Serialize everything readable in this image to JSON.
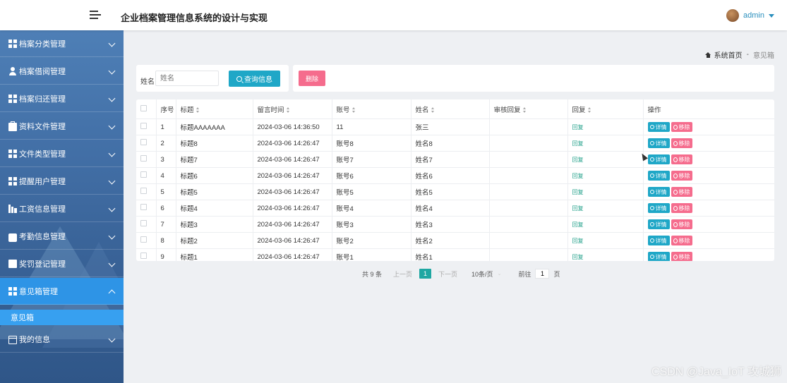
{
  "header": {
    "title": "企业档案管理信息系统的设计与实现",
    "username": "admin"
  },
  "sidebar": {
    "items": [
      {
        "label": "档案分类管理",
        "icon": "grid-icon"
      },
      {
        "label": "档案借阅管理",
        "icon": "user-icon"
      },
      {
        "label": "档案归还管理",
        "icon": "grid-icon"
      },
      {
        "label": "资料文件管理",
        "icon": "briefcase-icon"
      },
      {
        "label": "文件类型管理",
        "icon": "grid-icon"
      },
      {
        "label": "提醒用户管理",
        "icon": "grid-icon"
      },
      {
        "label": "工资信息管理",
        "icon": "bar-chart-icon"
      },
      {
        "label": "考勤信息管理",
        "icon": "drive-icon"
      },
      {
        "label": "奖罚登记管理",
        "icon": "checkbox-icon"
      },
      {
        "label": "意见箱管理",
        "icon": "grid-icon"
      },
      {
        "label": "我的信息",
        "icon": "card-icon"
      }
    ],
    "active_sub_item": "意见箱"
  },
  "breadcrumb": {
    "home": "系统首页",
    "separator": "-",
    "current": "意见箱"
  },
  "search": {
    "label": "姓名",
    "placeholder": "姓名",
    "button": "查询信息"
  },
  "actions": {
    "delete": "删除"
  },
  "table": {
    "headers": [
      "序号",
      "标题",
      "留言时间",
      "账号",
      "姓名",
      "审核回复",
      "回复",
      "操作"
    ],
    "rows": [
      {
        "no": "1",
        "title": "标题AAAAAAA",
        "time": "2024-03-06 14:36:50",
        "account": "11",
        "name": "张三",
        "review": "",
        "reply": "回复"
      },
      {
        "no": "2",
        "title": "标题8",
        "time": "2024-03-06 14:26:47",
        "account": "账号8",
        "name": "姓名8",
        "review": "",
        "reply": "回复"
      },
      {
        "no": "3",
        "title": "标题7",
        "time": "2024-03-06 14:26:47",
        "account": "账号7",
        "name": "姓名7",
        "review": "",
        "reply": "回复"
      },
      {
        "no": "4",
        "title": "标题6",
        "time": "2024-03-06 14:26:47",
        "account": "账号6",
        "name": "姓名6",
        "review": "",
        "reply": "回复"
      },
      {
        "no": "5",
        "title": "标题5",
        "time": "2024-03-06 14:26:47",
        "account": "账号5",
        "name": "姓名5",
        "review": "",
        "reply": "回复"
      },
      {
        "no": "6",
        "title": "标题4",
        "time": "2024-03-06 14:26:47",
        "account": "账号4",
        "name": "姓名4",
        "review": "",
        "reply": "回复"
      },
      {
        "no": "7",
        "title": "标题3",
        "time": "2024-03-06 14:26:47",
        "account": "账号3",
        "name": "姓名3",
        "review": "",
        "reply": "回复"
      },
      {
        "no": "8",
        "title": "标题2",
        "time": "2024-03-06 14:26:47",
        "account": "账号2",
        "name": "姓名2",
        "review": "",
        "reply": "回复"
      },
      {
        "no": "9",
        "title": "标题1",
        "time": "2024-03-06 14:26:47",
        "account": "账号1",
        "name": "姓名1",
        "review": "",
        "reply": "回复"
      }
    ],
    "detail_label": "详情",
    "remove_label": "移除"
  },
  "pagination": {
    "total": "共 9 条",
    "prev": "上一页",
    "current_page": "1",
    "next": "下一页",
    "page_size": "10条/页",
    "goto_label": "前往",
    "goto_value": "1",
    "page_suffix": "页"
  },
  "watermark": "CSDN @Java_IoT 攻城狮",
  "colors": {
    "primary": "#1fa7c7",
    "danger": "#f56c8d",
    "sidebar_active": "#2e94e6",
    "link": "#22a08a"
  }
}
